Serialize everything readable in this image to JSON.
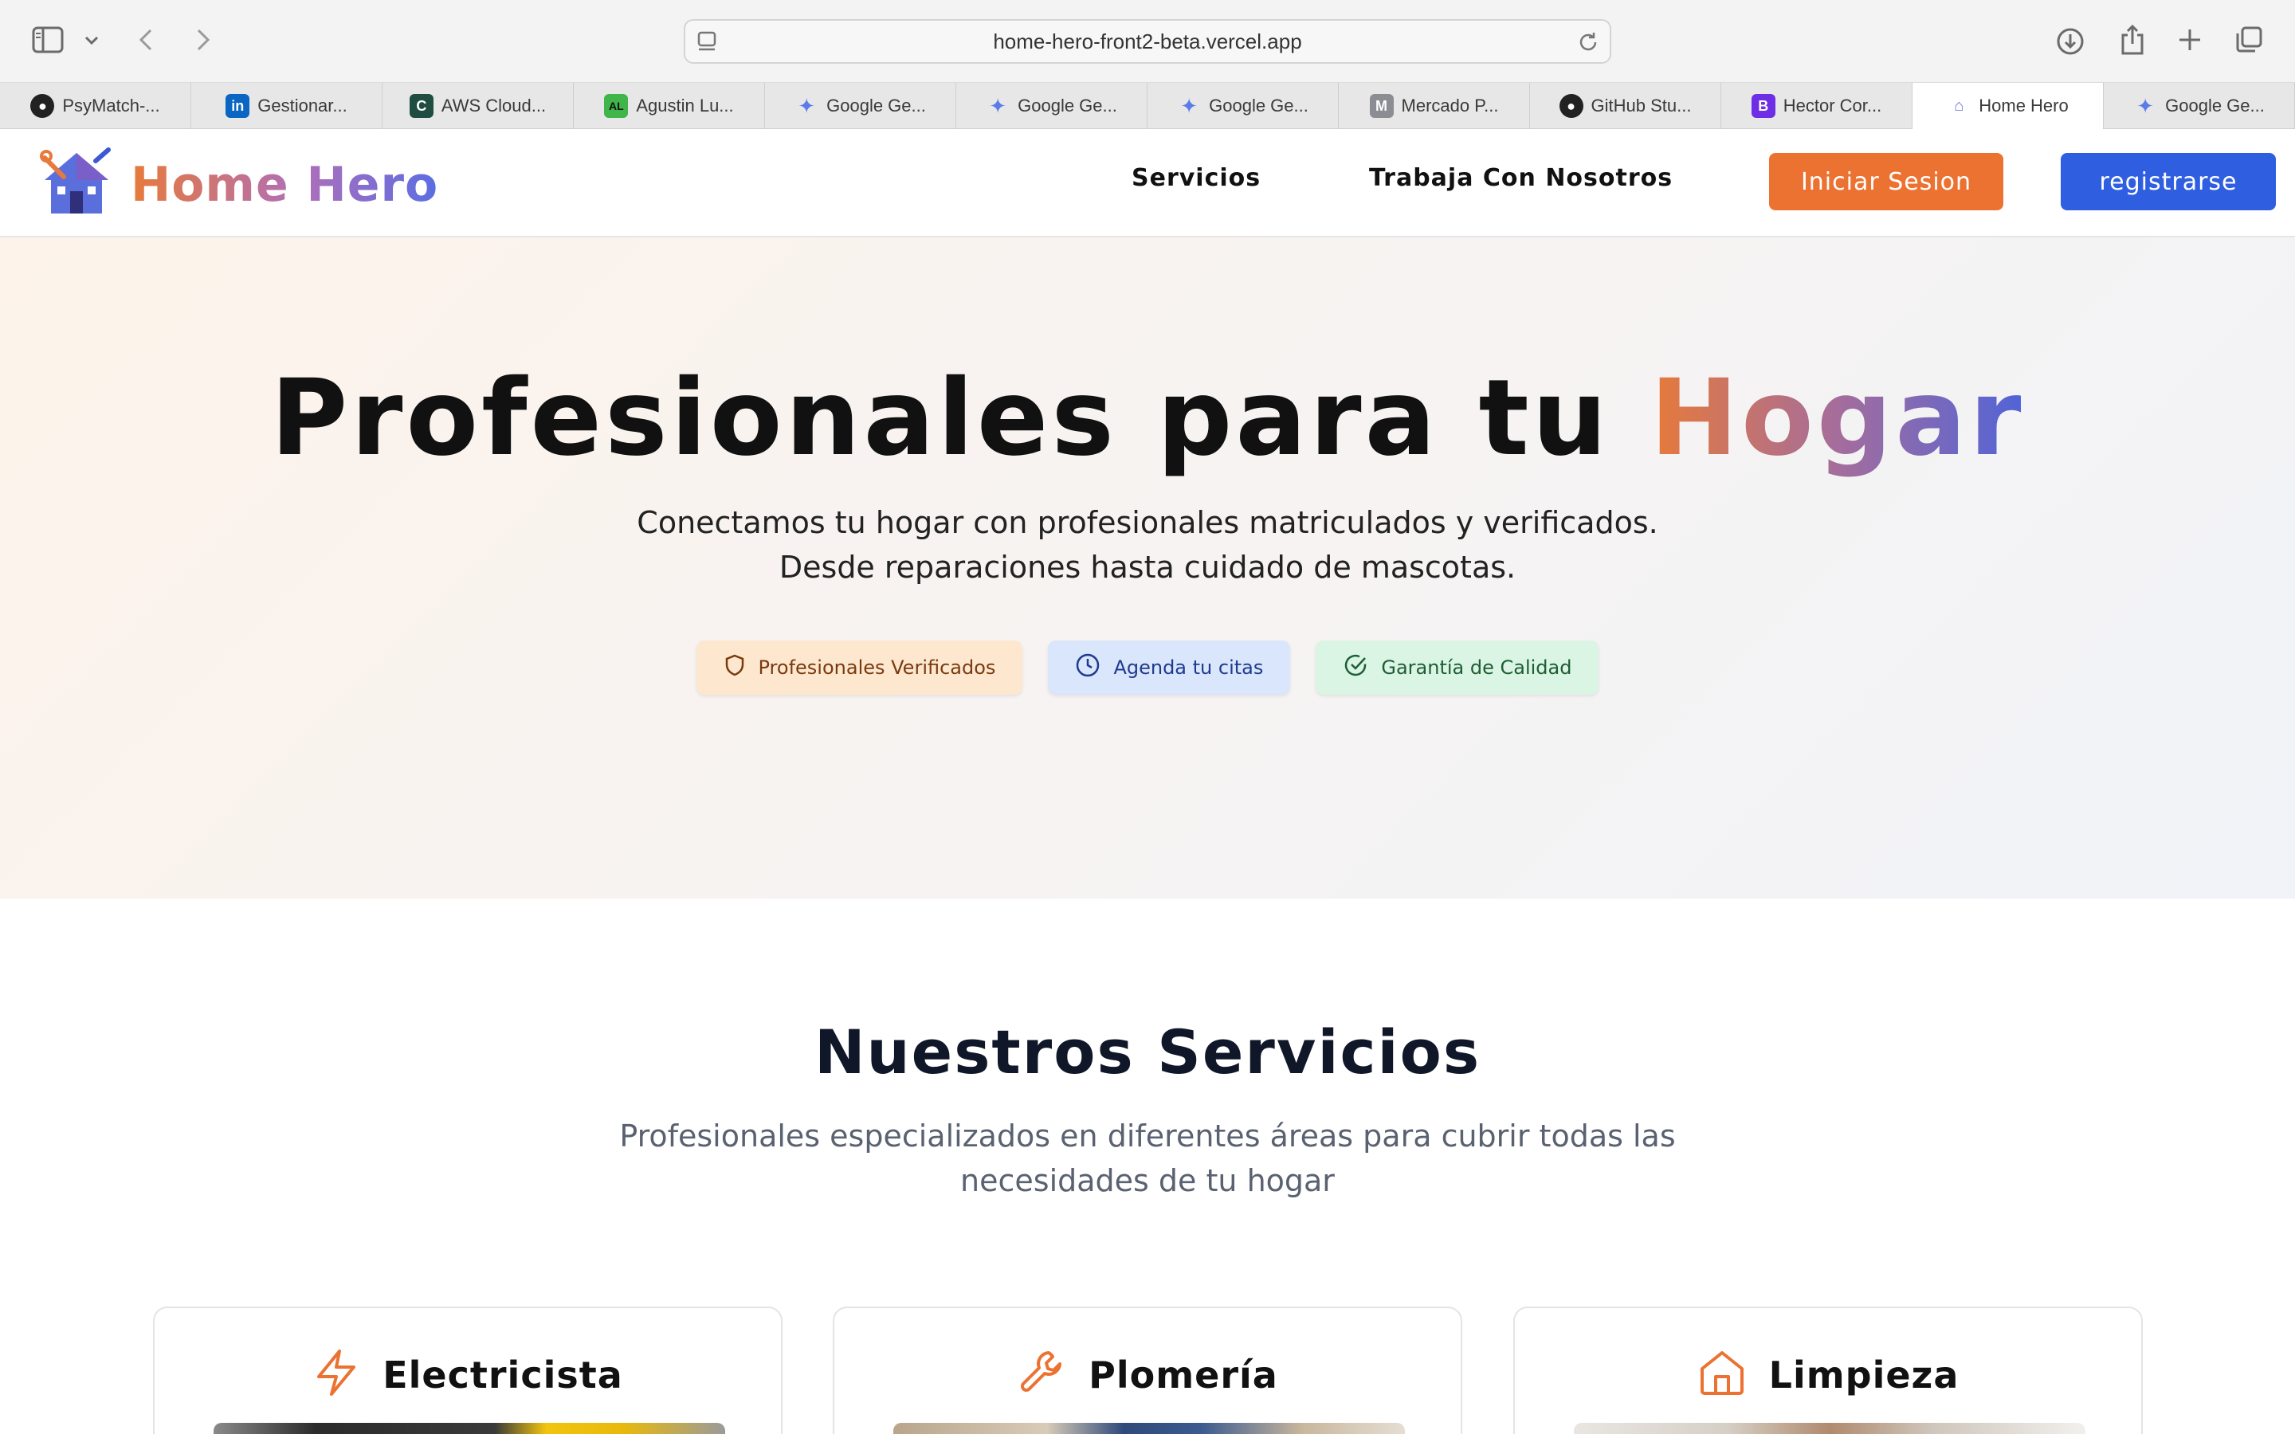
{
  "browser": {
    "url": "home-hero-front2-beta.vercel.app",
    "tabs": [
      {
        "label": "PsyMatch-...",
        "favicon": "github-icon",
        "active": false
      },
      {
        "label": "Gestionar...",
        "favicon": "linkedin-icon",
        "active": false
      },
      {
        "label": "AWS Cloud...",
        "favicon": "c-icon",
        "active": false
      },
      {
        "label": "Agustin Lu...",
        "favicon": "al-icon",
        "active": false
      },
      {
        "label": "Google Ge...",
        "favicon": "gemini-icon",
        "active": false
      },
      {
        "label": "Google Ge...",
        "favicon": "gemini-icon",
        "active": false
      },
      {
        "label": "Google Ge...",
        "favicon": "gemini-icon",
        "active": false
      },
      {
        "label": "Mercado P...",
        "favicon": "m-icon",
        "active": false
      },
      {
        "label": "GitHub Stu...",
        "favicon": "github-icon",
        "active": false
      },
      {
        "label": "Hector Cor...",
        "favicon": "b-icon",
        "active": false
      },
      {
        "label": "Home Hero",
        "favicon": "homehero-icon",
        "active": true
      },
      {
        "label": "Google Ge...",
        "favicon": "gemini-icon",
        "active": false
      }
    ]
  },
  "header": {
    "logo_text": "Home Hero",
    "nav": {
      "services": "Servicios",
      "work_with_us": "Trabaja Con Nosotros"
    },
    "login_label": "Iniciar Sesion",
    "register_label": "registrarse"
  },
  "hero": {
    "title_main": "Profesionales para tu ",
    "title_accent": "Hogar",
    "subtitle_line1": "Conectamos tu hogar con profesionales matriculados y verificados.",
    "subtitle_line2": "Desde reparaciones hasta cuidado de mascotas.",
    "badges": [
      {
        "label": "Profesionales Verificados",
        "icon": "shield-icon"
      },
      {
        "label": "Agenda tu citas",
        "icon": "clock-icon"
      },
      {
        "label": "Garantía de Calidad",
        "icon": "check-circle-icon"
      }
    ]
  },
  "services": {
    "title": "Nuestros Servicios",
    "subtitle_line1": "Profesionales especializados en diferentes áreas para cubrir todas las",
    "subtitle_line2": "necesidades de tu hogar",
    "cards": [
      {
        "title": "Electricista",
        "icon": "lightning-icon"
      },
      {
        "title": "Plomería",
        "icon": "wrench-icon"
      },
      {
        "title": "Limpieza",
        "icon": "house-icon"
      }
    ]
  },
  "colors": {
    "accent_orange": "#ec7232",
    "accent_blue": "#2f5fe0"
  }
}
